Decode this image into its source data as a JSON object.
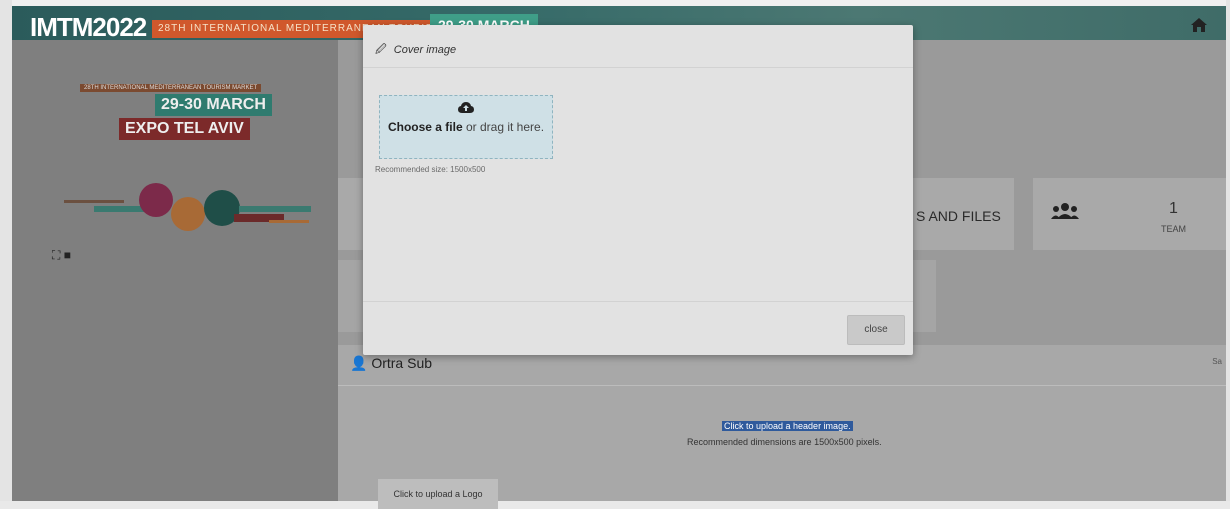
{
  "header": {
    "brand": "IMTM2022",
    "subtitle_strip": "28TH INTERNATIONAL MEDITERRANEAN TOURISM MARKET",
    "date": "29-30 MARCH",
    "home_icon": "home-icon"
  },
  "sidebar": {
    "logo_strip": "28TH INTERNATIONAL MEDITERRANEAN TOURISM MARKET",
    "logo_date": "29-30 MARCH",
    "logo_venue": "EXPO TEL AVIV",
    "fullscreen_icon": "fullscreen-icon"
  },
  "stats": {
    "files_label": "S AND FILES",
    "team_count": "1",
    "team_label": "TEAM"
  },
  "section": {
    "title": "Ortra Sub",
    "right_label": "Sa",
    "header_upload": "Click to upload a header image.",
    "header_rec": "Recommended dimensions are 1500x500 pixels.",
    "logo_upload": "Click to upload a Logo"
  },
  "modal": {
    "title": "Cover image",
    "choose_file": "Choose a file",
    "drag_text": "or drag it here.",
    "recommended": "Recommended size: 1500x500",
    "close_label": "close"
  },
  "colors": {
    "banner": "#356a68",
    "accent_orange": "#d0582c",
    "accent_teal": "#3f9e88",
    "drop_zone": "#cfe0e6"
  }
}
